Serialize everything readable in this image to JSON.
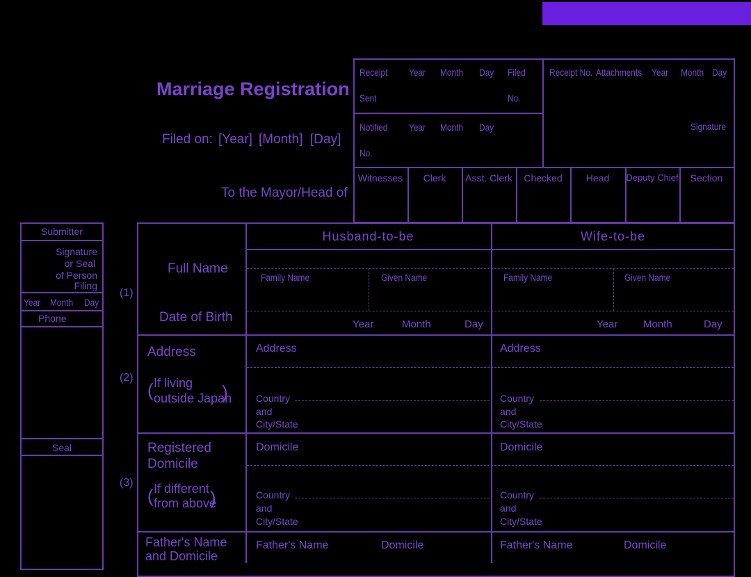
{
  "header": {
    "title": "Marriage Registration",
    "filed_on": {
      "label": "Filed on:",
      "year": "[Year]",
      "month": "[Month]",
      "day": "[Day]"
    },
    "addressee": "To the Mayor/Head of"
  },
  "office": {
    "receipt": "Receipt",
    "sent": "Sent",
    "notified": "Notified",
    "year": "Year",
    "month": "Month",
    "day": "Day",
    "filed": "Filed",
    "no": "No.",
    "receipt_no": "Receipt No.",
    "attachments": "Attachments",
    "signature": "Signature",
    "staff": [
      "Witnesses",
      "Clerk",
      "Asst. Clerk",
      "Checked",
      "Head",
      "Deputy Chief",
      "Section"
    ]
  },
  "submitter": {
    "title": "Submitter",
    "signature": [
      "Signature",
      "or Seal",
      "of Person",
      "Filing"
    ],
    "year": "Year",
    "month": "Month",
    "day": "Day",
    "phone": "Phone",
    "seal": "Seal"
  },
  "form": {
    "husband": "Husband-to-be",
    "wife": "Wife-to-be",
    "numbers": [
      "(1)",
      "(2)",
      "(3)"
    ],
    "full_name": "Full Name",
    "date_of_birth": "Date of Birth",
    "family_name": "Family Name",
    "given_name": "Given Name",
    "year": "Year",
    "month": "Month",
    "day": "Day",
    "address": "Address",
    "address_note": [
      "If living",
      "outside Japan"
    ],
    "country": "Country",
    "and": "and",
    "city_state": "City/State",
    "registered_domicile": [
      "Registered",
      "Domicile"
    ],
    "domicile_note": [
      "If different",
      "from above"
    ],
    "domicile": "Domicile",
    "fathers_row": [
      "Father's Name",
      "and Domicile"
    ],
    "fathers_name": "Father's Name"
  },
  "colors": {
    "background": "#000000",
    "ink": "#7a45cc",
    "accent_bar": "#6a1fe0"
  }
}
